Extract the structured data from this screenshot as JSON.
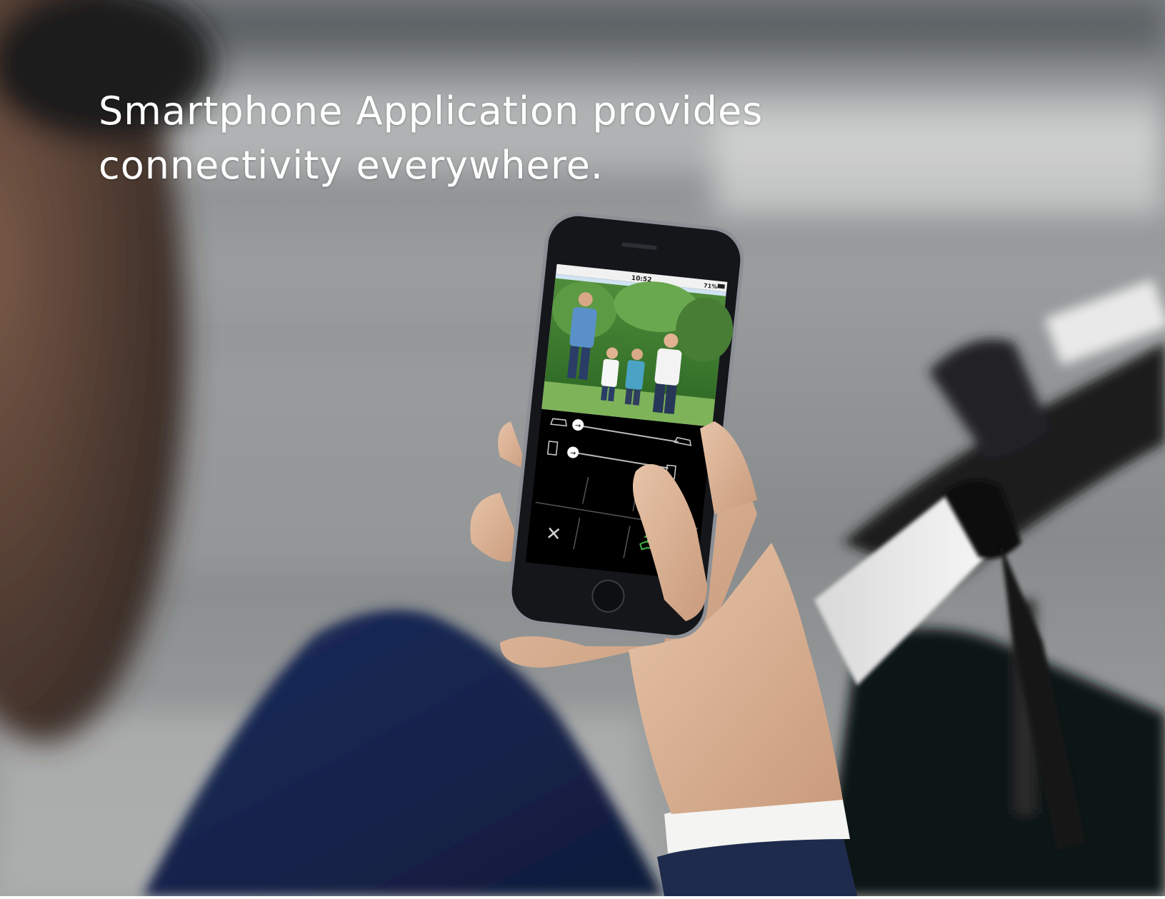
{
  "headline": {
    "line1": "Smartphone Application provides",
    "line2": "connectivity everywhere."
  },
  "phone_screen": {
    "status_time": "10:52",
    "status_battery": "71%",
    "controls": [
      "gate-slider",
      "door-slider",
      "dial-grid",
      "end-call",
      "answer-call"
    ]
  },
  "colors": {
    "background_blur": "#8a8d8f",
    "phone_body": "#1a1c1f",
    "answer_icon": "#3fb64a",
    "headline_text": "#ffffff"
  }
}
